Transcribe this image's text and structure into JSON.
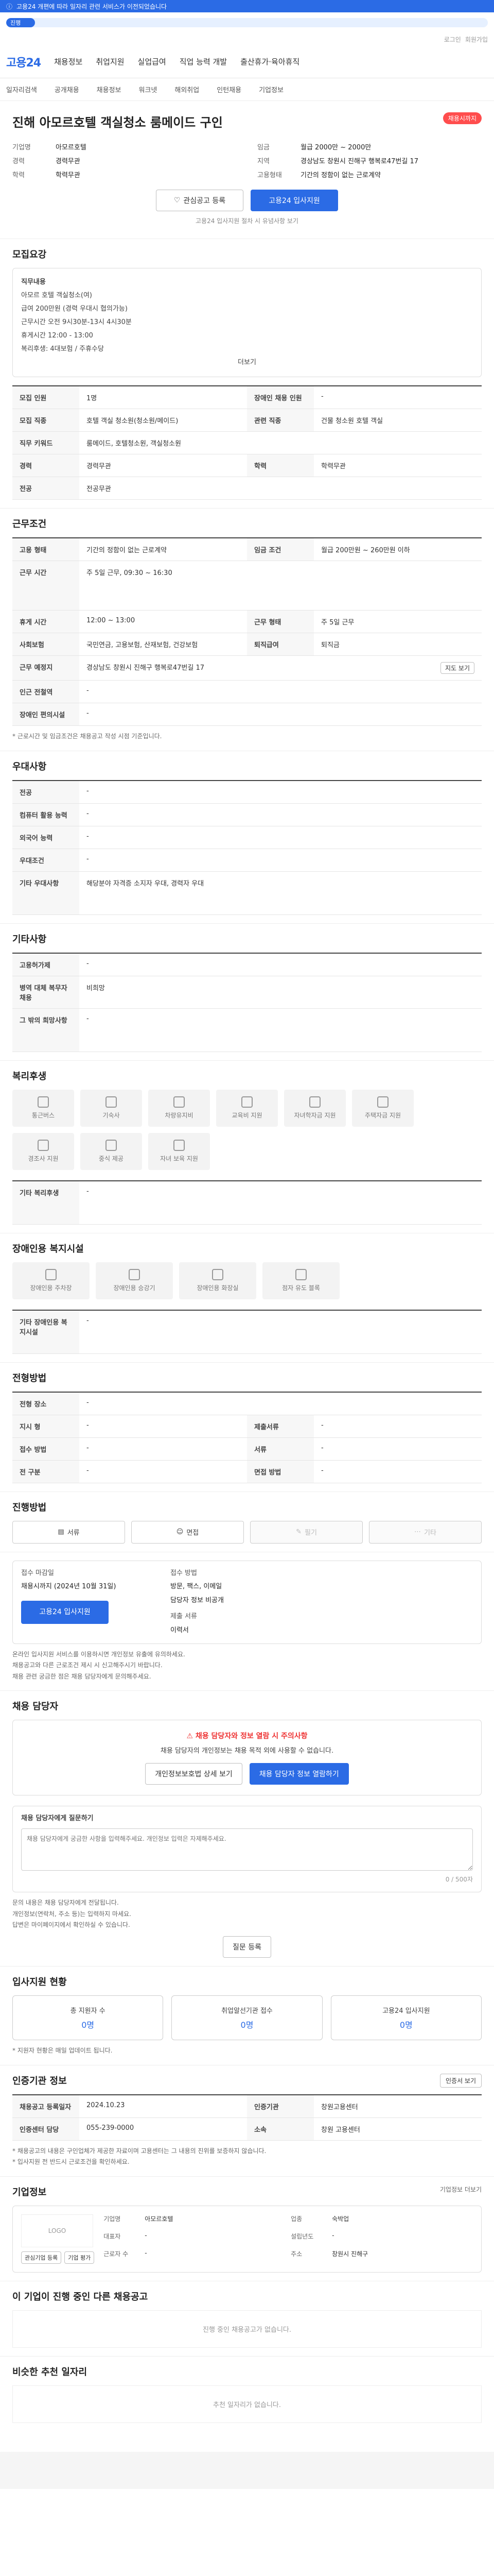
{
  "banner": {
    "text": "고용24 개편에 따라 일자리 관련 서비스가 이전되었습니다"
  },
  "progress": {
    "label": "진행",
    "percent": 6
  },
  "util": {
    "items": [
      "로그인",
      "회원가입"
    ]
  },
  "header": {
    "logo": "고용24",
    "nav": [
      "채용정보",
      "취업지원",
      "실업급여",
      "직업 능력 개발",
      "출산휴가·육아휴직"
    ]
  },
  "subnav": [
    "일자리검색",
    "공개채용",
    "채용정보",
    "워크넷",
    "해외취업",
    "인턴채용",
    "기업정보"
  ],
  "job": {
    "title": "진해 아모르호텔 객실청소 룸메이드 구인",
    "badge": "채용시까지",
    "summary_left": [
      {
        "k": "기업명",
        "v": "아모르호텔"
      },
      {
        "k": "경력",
        "v": "경력무관"
      },
      {
        "k": "학력",
        "v": "학력무관"
      }
    ],
    "summary_right": [
      {
        "k": "임금",
        "v": "월급 2000만 ~ 2000만"
      },
      {
        "k": "지역",
        "v": "경상남도 창원시 진해구 행복로47번길 17"
      },
      {
        "k": "고용형태",
        "v": "기간의 정함이 없는 근로계약"
      }
    ],
    "scrap": "관심공고 등록",
    "apply": "고용24 입사지원",
    "notice": "고용24 입사지원 절차 시 유념사항 보기"
  },
  "recruit": {
    "title": "모집요강",
    "box": [
      "직무내용",
      "아모르 호텔 객실청소(여)",
      "급여 200만원 (경력 우대시 협의가능)",
      "근무시간 오전 9시30분-13시 4시30분",
      "휴게시간 12:00 - 13:00",
      "복리후생: 4대보험 / 주휴수당"
    ],
    "more": "더보기",
    "rows": [
      {
        "k": "모집 인원",
        "v": "1명",
        "k2": "장애인 채용 인원",
        "v2": "-"
      },
      {
        "k": "모집 직종",
        "v": "호텔 객실 청소원(청소원/메이드)",
        "k2": "관련 직종",
        "v2": "건물 청소원 호텔 객실"
      },
      {
        "k": "직무 키워드",
        "v": "룸메이드, 호텔청소원, 객실청소원",
        "k2": "",
        "v2": ""
      },
      {
        "k": "경력",
        "v": "경력무관",
        "k2": "학력",
        "v2": "학력무관"
      },
      {
        "k": "전공",
        "v": "전공무관",
        "k2": "",
        "v2": ""
      }
    ]
  },
  "conditions": {
    "title": "근무조건",
    "rows": [
      {
        "k": "고용 형태",
        "v": "기간의 정함이 없는 근로계약",
        "k2": "임금 조건",
        "v2": "월급 200만원 ~ 260만원 이하"
      },
      {
        "k": "근무 시간",
        "v": "주 5일 근무, 09:30 ~ 16:30",
        "k2": "",
        "v2": ""
      },
      {
        "k": "휴게 시간",
        "v": "12:00 ~ 13:00",
        "k2": "근무 형태",
        "v2": "주 5일 근무"
      },
      {
        "k": "사회보험",
        "v": "국민연금, 고용보험, 산재보험, 건강보험",
        "k2": "퇴직급여",
        "v2": "퇴직금"
      },
      {
        "k": "근무 예정지",
        "v": "경상남도 창원시 진해구 행복로47번길 17",
        "k2": "",
        "v2": ""
      },
      {
        "k": "인근 전철역",
        "v": "-",
        "k2": "",
        "v2": ""
      },
      {
        "k": "장애인 편의시설",
        "v": "-",
        "k2": "",
        "v2": ""
      }
    ],
    "map_button": "지도 보기",
    "note": "* 근로시간 및 임금조건은 채용공고 작성 시점 기준입니다."
  },
  "prefer": {
    "title": "우대사항",
    "rows": [
      {
        "k": "전공",
        "v": "-"
      },
      {
        "k": "컴퓨터 활용 능력",
        "v": "-"
      },
      {
        "k": "외국어 능력",
        "v": "-"
      },
      {
        "k": "우대조건",
        "v": "-"
      },
      {
        "k": "기타 우대사항",
        "v": "해당분야 자격증 소지자 우대, 경력자 우대"
      }
    ]
  },
  "other": {
    "title": "기타사항",
    "rows": [
      {
        "k": "고용허가제",
        "v": "-"
      },
      {
        "k": "병역 대체 복무자 채용",
        "v": "비희망"
      },
      {
        "k": "그 밖의 희망사항",
        "v": "-"
      }
    ]
  },
  "welfare": {
    "title": "복리후생",
    "items": [
      "통근버스",
      "기숙사",
      "차량유지비",
      "교육비 지원",
      "자녀학자금 지원",
      "주택자금 지원",
      "경조사 지원",
      "중식 제공",
      "자녀 보육 지원"
    ],
    "other_label": "기타 복리후생",
    "other_value": "-"
  },
  "disabled": {
    "title": "장애인용 복지시설",
    "items": [
      "장애인용 주차장",
      "장애인용 승강기",
      "장애인용 화장실",
      "점자 유도 블록"
    ],
    "other_label": "기타 장애인용 복지시설",
    "other_value": "-"
  },
  "method": {
    "title": "전형방법",
    "rows": [
      {
        "k": "전형 장소",
        "v": "-"
      },
      {
        "k": "지시 형",
        "v": "-",
        "k2": "제출서류",
        "v2": "-"
      },
      {
        "k": "접수 방법",
        "v": "-",
        "k2": "서류",
        "v2": "-"
      },
      {
        "k": "전 구분",
        "v": "-",
        "k2": "면접 방법",
        "v2": "-"
      }
    ]
  },
  "status": {
    "title": "진행방법",
    "buttons": [
      "서류",
      "면접",
      "필기",
      "기타"
    ]
  },
  "contact": {
    "deadline_label": "접수 마감일",
    "deadline_value": "채용시까지 (2024년 10월 31일)",
    "apply": "고용24 입사지원",
    "contact_label": "접수 방법",
    "contact_values": [
      "방문, 팩스, 이메일",
      "담당자 정보 비공개"
    ],
    "rcpt_label": "제출 서류",
    "rcpt_value": "이력서",
    "notes": [
      "온라인 입사지원 서비스를 이용하시면 개인정보 유출에 유의하세요.",
      "채용공고와 다른 근로조건 제시 시 신고해주시기 바랍니다.",
      "채용 관련 궁금한 점은 채용 담당자에게 문의해주세요."
    ]
  },
  "inquiry": {
    "title": "채용 담당자",
    "warn_title": "채용 담당자와 정보 열람 시 주의사항",
    "warn_text": "채용 담당자의 개인정보는 채용 목적 외에 사용할 수 없습니다.",
    "buttons": [
      "개인정보보호법 상세 보기",
      "채용 담당자 정보 열람하기"
    ],
    "question_title": "채용 담당자에게 질문하기",
    "question_placeholder": "채용 담당자에게 궁금한 사항을 입력해주세요. 개인정보 입력은 자제해주세요.",
    "counter": "0 / 500자",
    "bullets": [
      "문의 내용은 채용 담당자에게 전달됩니다.",
      "개인정보(연락처, 주소 등)는 입력하지 마세요.",
      "답변은 마이페이지에서 확인하실 수 있습니다."
    ],
    "send": "질문 등록"
  },
  "applicants": {
    "title": "입사지원 현황",
    "cards": [
      {
        "l": "총 지원자 수",
        "v": "0명"
      },
      {
        "l": "취업알선기관 접수",
        "v": "0명"
      },
      {
        "l": "고용24 입사지원",
        "v": "0명"
      }
    ],
    "note": "* 지원자 현황은 매일 업데이트 됩니다."
  },
  "agency": {
    "title": "인증기관 정보",
    "button": "인증서 보기",
    "rows": [
      {
        "k": "채용공고 등록일자",
        "v": "2024.10.23",
        "k2": "인증기관",
        "v2": "창원고용센터"
      },
      {
        "k": "인증센터 담당",
        "v": "055-239-0000",
        "k2": "소속",
        "v2": "창원 고용센터"
      }
    ],
    "notes": [
      "* 채용공고의 내용은 구인업체가 제공한 자료이며 고용센터는 그 내용의 진위를 보증하지 않습니다.",
      "* 입사지원 전 반드시 근로조건을 확인하세요."
    ]
  },
  "company": {
    "title": "기업정보",
    "more": "기업정보 더보기",
    "logo": "LOGO",
    "rows": [
      {
        "k": "기업명",
        "v": "아모르호텔",
        "k2": "업종",
        "v2": "숙박업"
      },
      {
        "k": "대표자",
        "v": "-",
        "k2": "설립년도",
        "v2": "-"
      },
      {
        "k": "근로자 수",
        "v": "-",
        "k2": "주소",
        "v2": "창원시 진해구"
      }
    ],
    "btn1": "관심기업 등록",
    "btn2": "기업 평가"
  },
  "similar": {
    "title": "이 기업이 진행 중인 다른 채용공고",
    "empty": "진행 중인 채용공고가 없습니다."
  },
  "recommend": {
    "title": "비슷한 추천 일자리",
    "empty": "추천 일자리가 없습니다."
  },
  "colors": {
    "primary": "#2b6be5",
    "accent": "#e33333"
  }
}
